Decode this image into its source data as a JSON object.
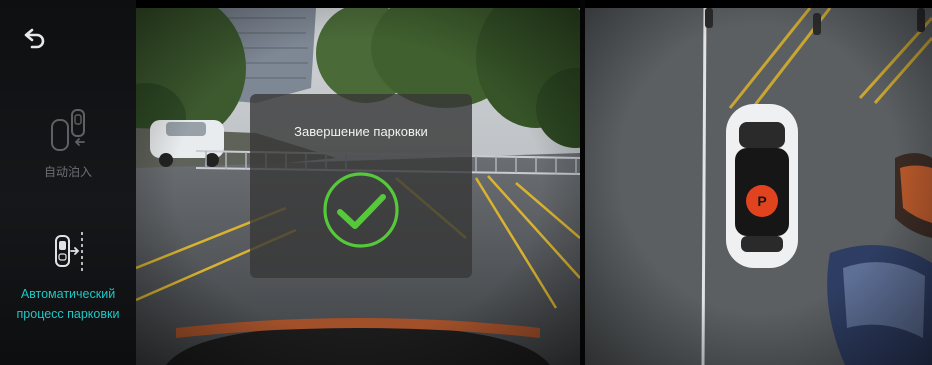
{
  "sidebar": {
    "back_icon": "back-arrow-icon",
    "modes": [
      {
        "label": "自动泊入",
        "icon": "auto-park-in-icon",
        "active": false
      },
      {
        "label_lines": [
          "Автоматический",
          "процесс парковки"
        ],
        "icon": "parking-process-icon",
        "active": true
      }
    ]
  },
  "overlay": {
    "title": "Завершение парковки",
    "icon": "checkmark-circle-icon"
  },
  "colors": {
    "accent": "#1fc7c4",
    "success": "#55c93a",
    "inactive": "#6c6f73",
    "marker": "#e2431f"
  }
}
